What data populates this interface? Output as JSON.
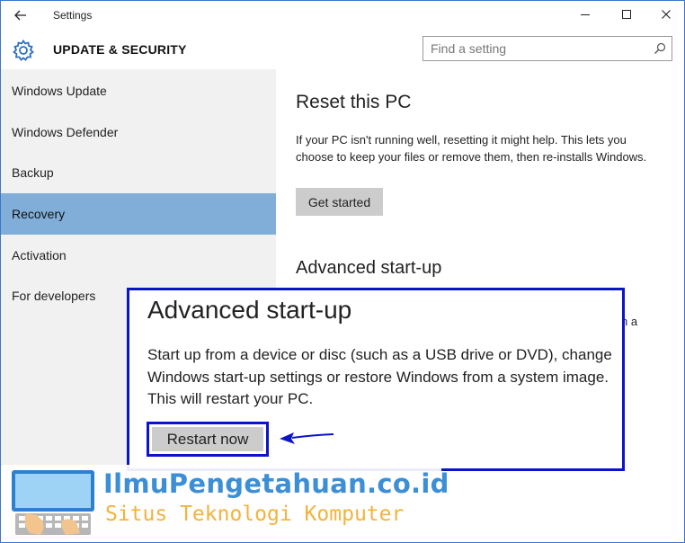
{
  "window": {
    "app_title": "Settings"
  },
  "header": {
    "section_title": "UPDATE & SECURITY",
    "search_placeholder": "Find a setting"
  },
  "sidebar": {
    "items": [
      {
        "label": "Windows Update"
      },
      {
        "label": "Windows Defender"
      },
      {
        "label": "Backup"
      },
      {
        "label": "Recovery"
      },
      {
        "label": "Activation"
      },
      {
        "label": "For developers"
      }
    ],
    "selected": "Recovery"
  },
  "main": {
    "reset": {
      "heading": "Reset this PC",
      "description": "If your PC isn't running well, resetting it might help. This lets you choose to keep your files or remove them, then re-installs Windows.",
      "button_label": "Get started"
    },
    "advanced": {
      "heading": "Advanced start-up",
      "partial_text": "n a"
    }
  },
  "callout": {
    "heading": "Advanced start-up",
    "description": "Start up from a device or disc (such as a USB drive or DVD), change Windows start-up settings or restore Windows from a system image. This will restart your PC.",
    "button_label": "Restart now"
  },
  "watermark": {
    "title": "IlmuPengetahuan.co.id",
    "subtitle": "Situs Teknologi Komputer"
  },
  "colors": {
    "sidebar_selected": "#80aed8",
    "sidebar_bg": "#f1f1f1",
    "highlight_border": "#0a14c8",
    "button_bg": "#cccccc",
    "watermark_blue": "#3c8fd6",
    "watermark_orange": "#f2b33d"
  },
  "icons": [
    "back-arrow-icon",
    "minimize-icon",
    "maximize-icon",
    "close-icon",
    "gear-icon",
    "search-icon",
    "arrow-pointer-icon",
    "keyboard-logo-icon"
  ]
}
